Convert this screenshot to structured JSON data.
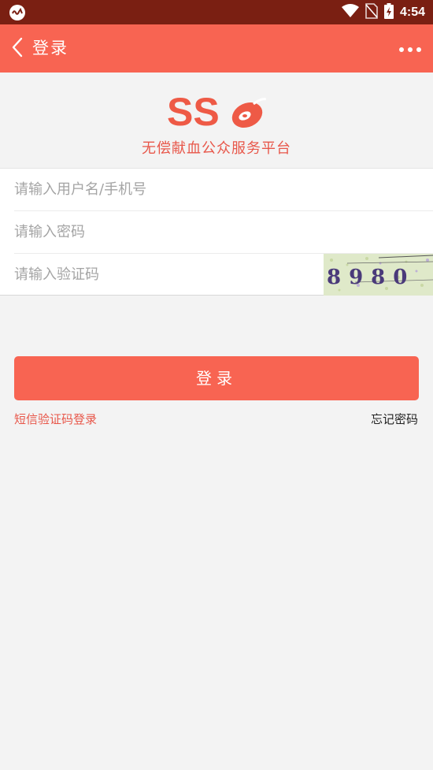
{
  "status_bar": {
    "time": "4:54"
  },
  "app_bar": {
    "title": "登录"
  },
  "header": {
    "logo_text": "SS",
    "slogan": "无偿献血公众服务平台"
  },
  "form": {
    "username_placeholder": "请输入用户名/手机号",
    "password_placeholder": "请输入密码",
    "captcha_placeholder": "请输入验证码",
    "captcha_code": "8980"
  },
  "actions": {
    "login_label": "登录",
    "sms_login_label": "短信验证码登录",
    "forgot_password_label": "忘记密码"
  },
  "colors": {
    "accent": "#f86452",
    "status_bar": "#7a1f12",
    "background": "#f3f3f3"
  }
}
